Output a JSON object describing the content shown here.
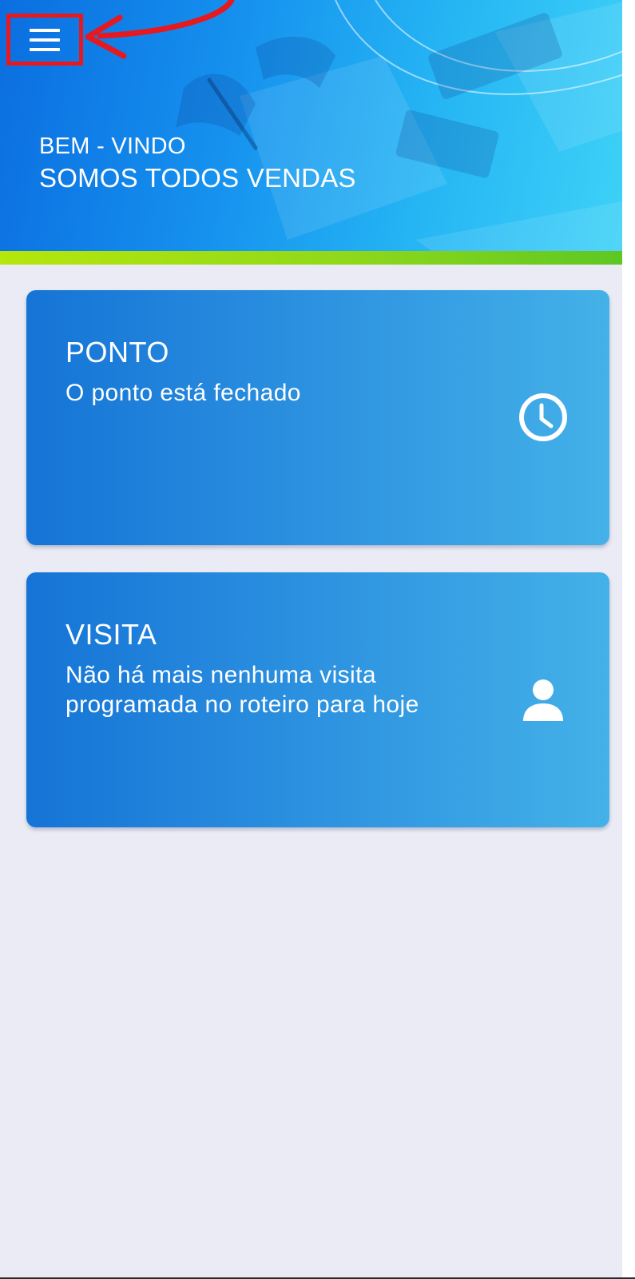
{
  "header": {
    "welcome": "BEM - VINDO",
    "subtitle": "SOMOS TODOS VENDAS",
    "menu_icon": "hamburger-menu-icon"
  },
  "cards": [
    {
      "title": "PONTO",
      "text": "O ponto está fechado",
      "icon": "clock-icon"
    },
    {
      "title": "VISITA",
      "text": "Não há mais nenhuma visita programada no roteiro para hoje",
      "icon": "person-icon"
    }
  ],
  "colors": {
    "header_gradient_start": "#0b6ee0",
    "header_gradient_end": "#3fd3f7",
    "accent_strip": "#8fd81a",
    "card_gradient_start": "#1574d6",
    "card_gradient_end": "#44b1e8",
    "page_background": "#eaebf4",
    "annotation_red": "#e5191f"
  }
}
